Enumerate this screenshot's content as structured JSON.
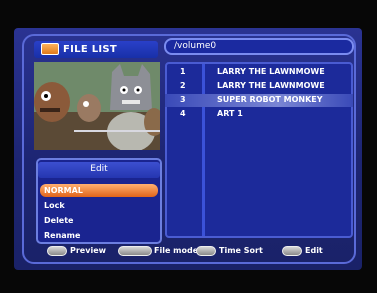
{
  "header": {
    "title": "FILE LIST",
    "path": "/volume0",
    "folder_icon": "folder-icon"
  },
  "files": [
    {
      "num": "1",
      "title": "LARRY THE LAWNMOWE"
    },
    {
      "num": "2",
      "title": "LARRY THE LAWNMOWE"
    },
    {
      "num": "3",
      "title": "SUPER ROBOT MONKEY",
      "selected": true
    },
    {
      "num": "4",
      "title": "ART 1"
    }
  ],
  "edit_menu": {
    "title": "Edit",
    "items": [
      "NORMAL",
      "Lock",
      "Delete",
      "Rename"
    ],
    "selected": "NORMAL"
  },
  "footer": {
    "preview": "Preview",
    "file_mode": "File mode",
    "time_sort": "Time Sort",
    "edit": "Edit"
  },
  "colors": {
    "background": "#1d2573",
    "highlight": "#e0641a",
    "accent": "#4a5cd2"
  }
}
